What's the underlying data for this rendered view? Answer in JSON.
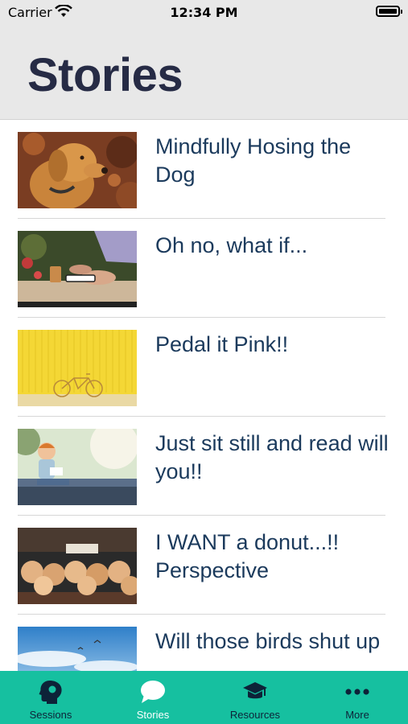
{
  "status_bar": {
    "carrier": "Carrier",
    "time": "12:34 PM"
  },
  "header": {
    "title": "Stories"
  },
  "stories": [
    {
      "title": "Mindfully Hosing the Dog",
      "thumbnail": "golden-retriever-photo"
    },
    {
      "title": "Oh no, what if...",
      "thumbnail": "phone-in-hand-photo"
    },
    {
      "title": "Pedal it Pink!!",
      "thumbnail": "yellow-wall-bicycle-photo"
    },
    {
      "title": "Just sit still and read will you!!",
      "thumbnail": "child-reading-on-bench-photo"
    },
    {
      "title": "I WANT a donut...!! Perspective",
      "thumbnail": "donut-display-photo"
    },
    {
      "title": "Will those birds shut up",
      "thumbnail": "sky-birds-photo"
    }
  ],
  "tab_bar": {
    "tabs": [
      {
        "label": "Sessions",
        "icon": "head-silhouette-icon",
        "active": false
      },
      {
        "label": "Stories",
        "icon": "speech-bubble-icon",
        "active": true
      },
      {
        "label": "Resources",
        "icon": "graduation-cap-icon",
        "active": false
      },
      {
        "label": "More",
        "icon": "ellipsis-icon",
        "active": false
      }
    ]
  },
  "colors": {
    "tab_bar_bg": "#16c0a0",
    "title_text": "#262b45",
    "story_text": "#1b3a5c",
    "header_bg": "#e8e8e8"
  }
}
